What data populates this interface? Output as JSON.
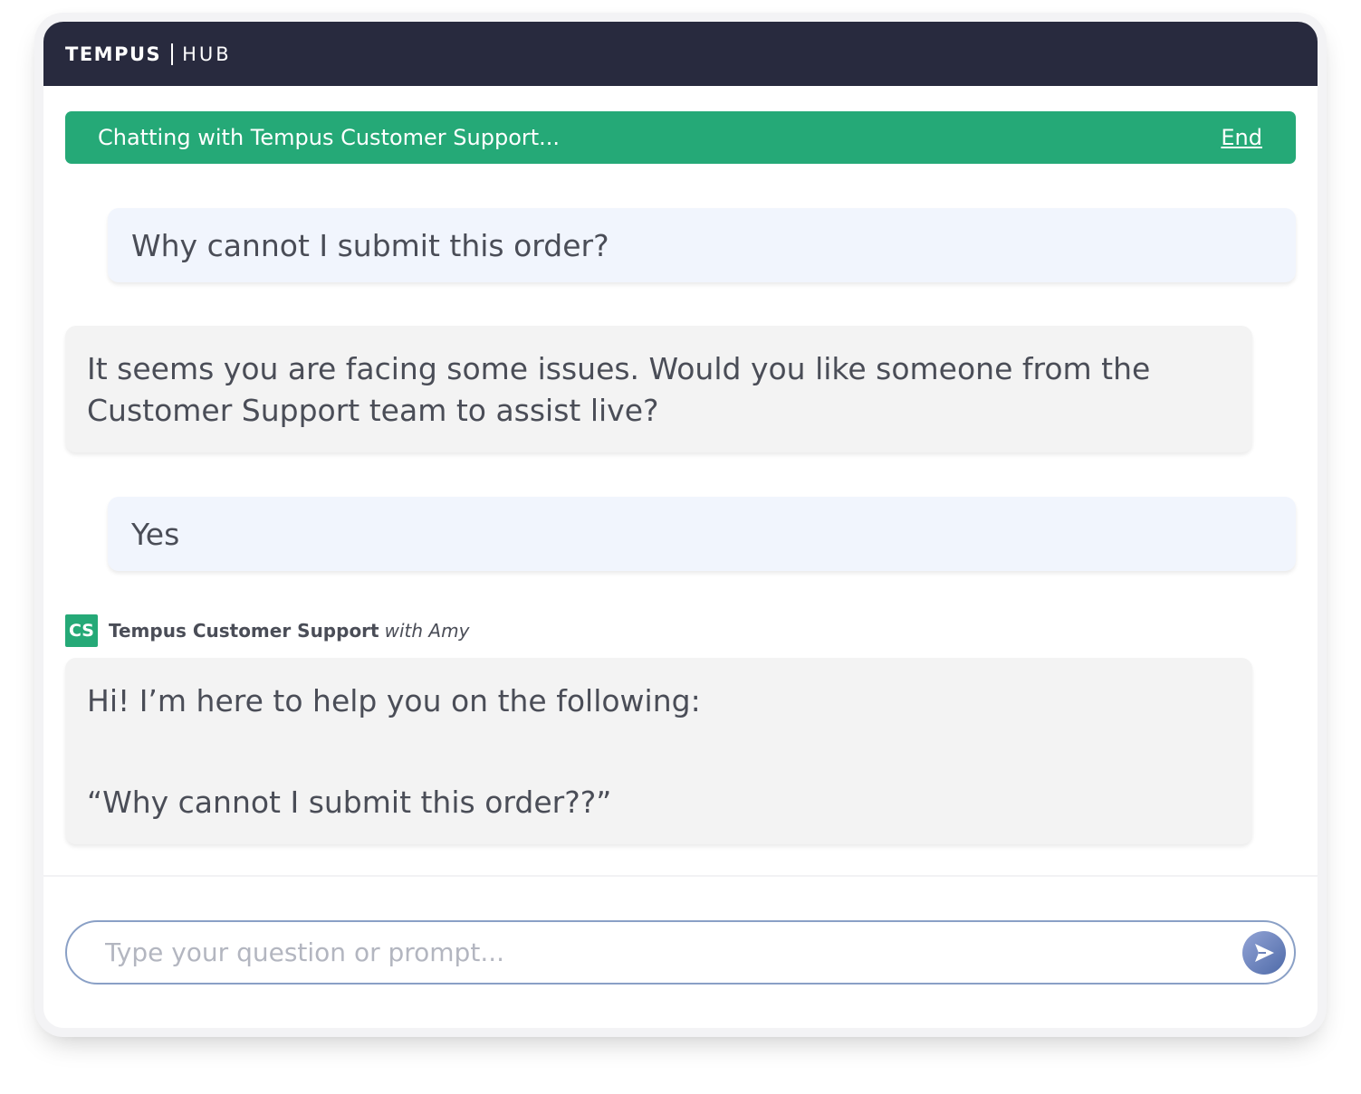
{
  "app": {
    "brand": "TEMPUS",
    "product": "HUB"
  },
  "status_bar": {
    "text": "Chatting with Tempus Customer Support...",
    "end_label": "End",
    "color": "#25a977"
  },
  "messages": [
    {
      "role": "user",
      "text": "Why cannot I submit this order?"
    },
    {
      "role": "agent",
      "lines": [
        "It seems you are facing some issues. Would you like someone from the",
        "Customer Support team to assist live?"
      ]
    },
    {
      "role": "user",
      "text": "Yes"
    },
    {
      "role": "agent",
      "lines": [
        "Hi! I’m here to help you on the following:",
        "“Why cannot I submit this order??”"
      ]
    }
  ],
  "agent_header": {
    "avatar_initials": "CS",
    "name": "Tempus Customer Support",
    "with": "with Amy"
  },
  "input": {
    "placeholder": "Type your question or prompt...",
    "value": "",
    "send_icon": "send-arrow-icon"
  }
}
